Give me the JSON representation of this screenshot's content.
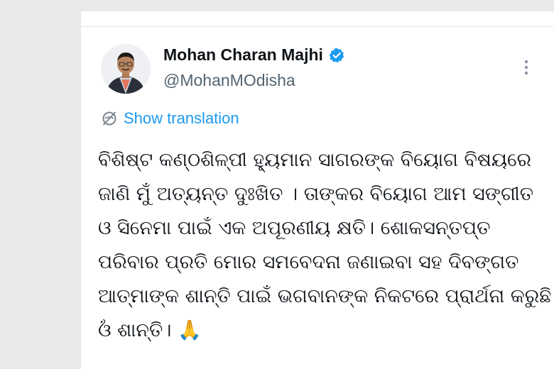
{
  "author": {
    "display_name": "Mohan Charan Majhi",
    "handle": "@MohanMOdisha",
    "verified": true
  },
  "translate": {
    "label": "Show translation"
  },
  "tweet": {
    "lines": [
      "ବିଶିଷ୍ଟ କଣ୍ଠଶିଳ୍ପୀ ହ୍ୟୁମାନ ସାଗରଙ୍କ ବିୟୋଗ ବିଷୟରେ",
      "ଜାଣି ମୁଁ ଅତ୍ୟନ୍ତ ଦୁଃଖିତ । ତାଙ୍କର ବିୟୋଗ ଆମ ସଙ୍ଗୀତ",
      "ଓ ସିନେମା ପାଇଁ ଏକ ଅପୂରଣୀୟ କ୍ଷତି। ଶୋକସନ୍ତପ୍ତ",
      "ପରିବାର ପ୍ରତି ମୋର ସମବେଦନା ଜଣାଇବା ସହ ଦିବଙ୍ଗତ",
      "ଆତ୍ମାଙ୍କ ଶାନ୍ତି ପାଇଁ ଭଗବାନଙ୍କ ନିକଟରେ ପ୍ରାର୍ଥନା କରୁଛି।",
      "ଓଁ ଶାନ୍ତି।"
    ],
    "emoji": "🙏"
  },
  "icons": {
    "verified": "verified-badge-icon",
    "more": "more-options-icon",
    "translate": "globe-icon"
  },
  "colors": {
    "link": "#1d9bf0",
    "verified": "#1d9bf0",
    "text": "#0f1419",
    "muted": "#536471"
  }
}
